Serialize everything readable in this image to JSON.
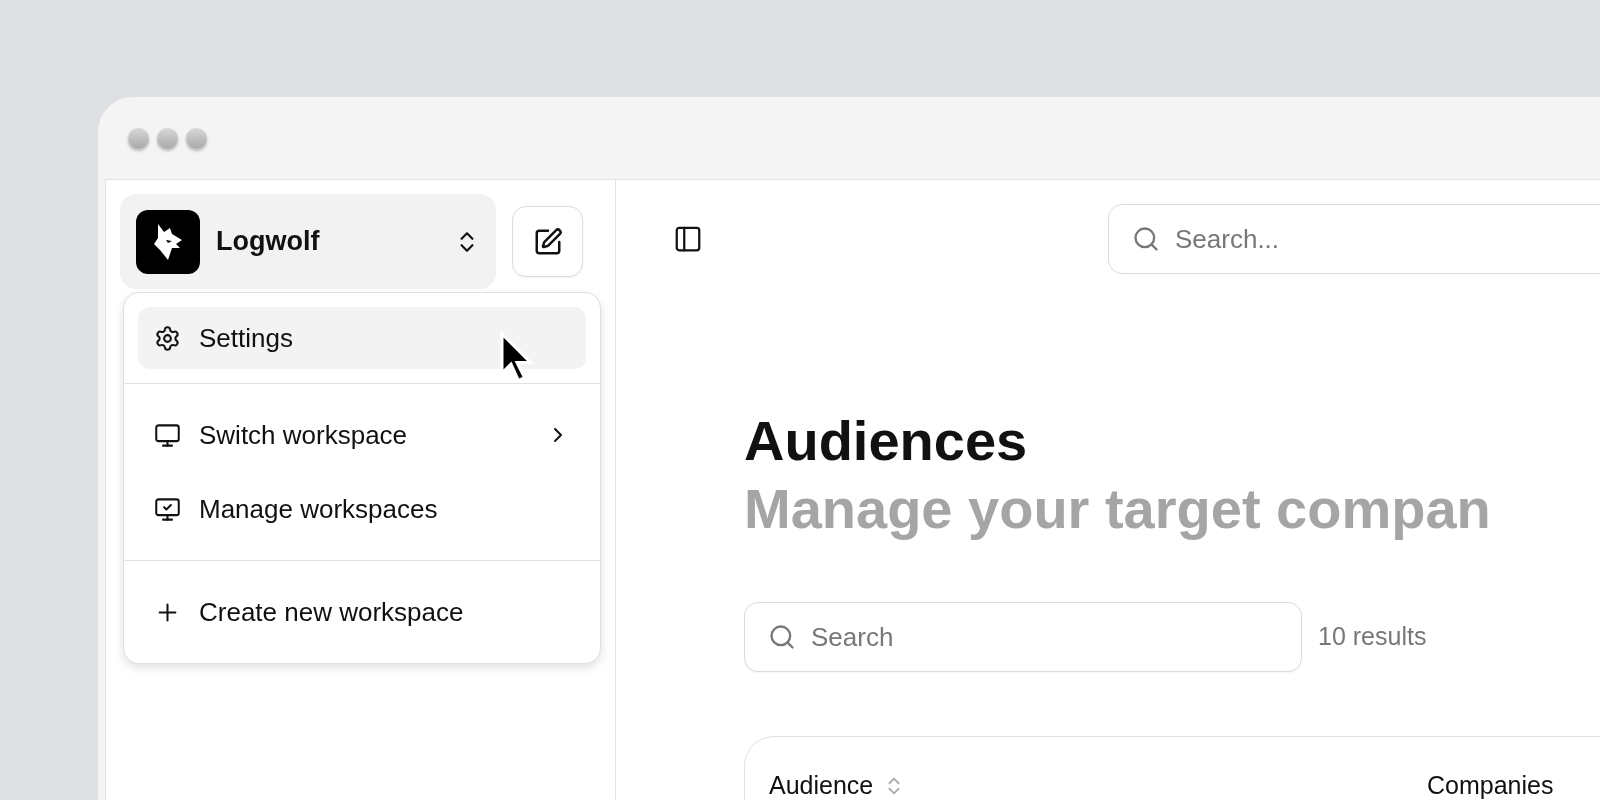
{
  "workspace": {
    "name": "Logwolf"
  },
  "menu": {
    "sections": [
      [
        {
          "kind": "gear",
          "label": "Settings",
          "selected": true,
          "submenu": false
        }
      ],
      [
        {
          "kind": "monitor",
          "label": "Switch workspace",
          "selected": false,
          "submenu": true
        },
        {
          "kind": "monitor-check",
          "label": "Manage workspaces",
          "selected": false,
          "submenu": false
        }
      ],
      [
        {
          "kind": "plus",
          "label": "Create new workspace",
          "selected": false,
          "submenu": false
        }
      ]
    ]
  },
  "top_search": {
    "placeholder": "Search..."
  },
  "page": {
    "title": "Audiences",
    "subtitle": "Manage your target compan"
  },
  "filter": {
    "placeholder": "Search",
    "result_count": "10 results"
  },
  "table": {
    "columns": [
      "Audience",
      "Companies"
    ]
  }
}
